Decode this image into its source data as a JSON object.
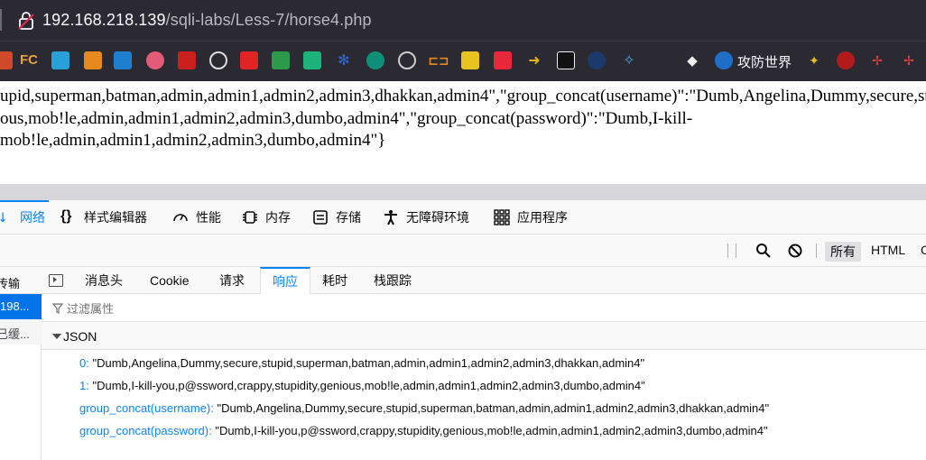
{
  "url_bar": {
    "host": "192.168.218.139",
    "path": "/sqli-labs/Less-7/horse4.php"
  },
  "bookmarks": {
    "icons": [
      "rocket-icon",
      "fc-icon",
      "folder-icon",
      "box-icon",
      "vue-icon",
      "flower-icon",
      "seal-icon",
      "github-icon",
      "c-icon",
      "grid-icon",
      "doc-icon",
      "snowflake-icon",
      "c-circle-icon",
      "globe-icon",
      "bracket-icon",
      "face-icon",
      "card-icon",
      "arrow-icon",
      "cast-icon",
      "shield-icon",
      "puzzle-icon",
      "bird-icon",
      "pin-icon",
      "star-icon",
      "rose-icon",
      "flag-icon"
    ],
    "fc_label": "FC",
    "gongfang_label": "攻防世界"
  },
  "page": {
    "line1": "upid,superman,batman,admin,admin1,admin2,admin3,dhakkan,admin4\",\"group_concat(username)\":\"Dumb,Angelina,Dummy,secure,st",
    "line2": "ous,mob!le,admin,admin1,admin2,admin3,dumbo,admin4\",\"group_concat(password)\":\"Dumb,I-kill-",
    "line3": "mob!le,admin,admin1,admin2,admin3,dumbo,admin4\"}"
  },
  "devtools": {
    "tabs": [
      {
        "label": "网络",
        "icon": "network-icon"
      },
      {
        "label": "样式编辑器",
        "icon": "braces-icon"
      },
      {
        "label": "性能",
        "icon": "gauge-icon"
      },
      {
        "label": "内存",
        "icon": "chip-icon"
      },
      {
        "label": "存储",
        "icon": "storage-icon"
      },
      {
        "label": "无障碍环境",
        "icon": "accessibility-icon"
      },
      {
        "label": "应用程序",
        "icon": "apps-icon"
      }
    ],
    "filter_buttons": {
      "all": "所有",
      "html": "HTML",
      "more": "C"
    },
    "request_list": {
      "header": "传输",
      "selected_row": "198...",
      "row2": "已缓..."
    },
    "detail_tabs": [
      "消息头",
      "Cookie",
      "请求",
      "响应",
      "耗时",
      "栈跟踪"
    ],
    "filter_placeholder": "过滤属性",
    "json_section": "JSON",
    "json": [
      {
        "key": "0:",
        "value": "\"Dumb,Angelina,Dummy,secure,stupid,superman,batman,admin,admin1,admin2,admin3,dhakkan,admin4\""
      },
      {
        "key": "1:",
        "value": "\"Dumb,I-kill-you,p@ssword,crappy,stupidity,genious,mob!le,admin,admin1,admin2,admin3,dumbo,admin4\""
      },
      {
        "key": "group_concat(username):",
        "value": "\"Dumb,Angelina,Dummy,secure,stupid,superman,batman,admin,admin1,admin2,admin3,dhakkan,admin4\""
      },
      {
        "key": "group_concat(password):",
        "value": "\"Dumb,I-kill-you,p@ssword,crappy,stupidity,genious,mob!le,admin,admin1,admin2,admin3,dumbo,admin4\""
      }
    ]
  }
}
